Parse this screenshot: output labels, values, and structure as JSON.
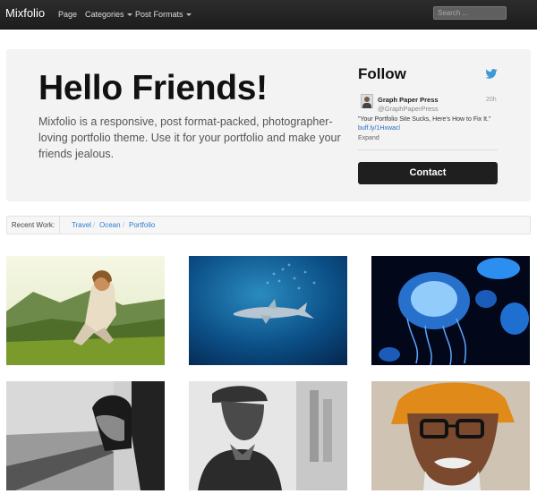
{
  "nav": {
    "brand": "Mixfolio",
    "items": [
      {
        "label": "Page",
        "dropdown": false
      },
      {
        "label": "Categories",
        "dropdown": true
      },
      {
        "label": "Post Formats",
        "dropdown": true
      }
    ],
    "search_placeholder": "Search ..."
  },
  "hero": {
    "title": "Hello Friends!",
    "text": "Mixfolio is a responsive, post format-packed, photographer-loving portfolio theme. Use it for your portfolio and make your friends jealous."
  },
  "follow": {
    "title": "Follow",
    "icon": "twitter-bird-icon",
    "tweet": {
      "name": "Graph Paper Press",
      "handle": "@GraphPaperPress",
      "time": "20h",
      "text": "\"Your Portfolio Site Sucks, Here's How to Fix It.\"",
      "link": "buff.ly/1Hxwacl",
      "expand": "Expand"
    },
    "contact_label": "Contact"
  },
  "recent": {
    "label": "Recent Work:",
    "links": [
      "Travel",
      "Ocean",
      "Portfolio"
    ],
    "separator": "/"
  },
  "gallery": [
    {
      "name": "photo-woman-hillside"
    },
    {
      "name": "photo-shark-underwater"
    },
    {
      "name": "photo-jellyfish"
    },
    {
      "name": "photo-train-window"
    },
    {
      "name": "photo-man-cap"
    },
    {
      "name": "photo-man-turban"
    }
  ]
}
